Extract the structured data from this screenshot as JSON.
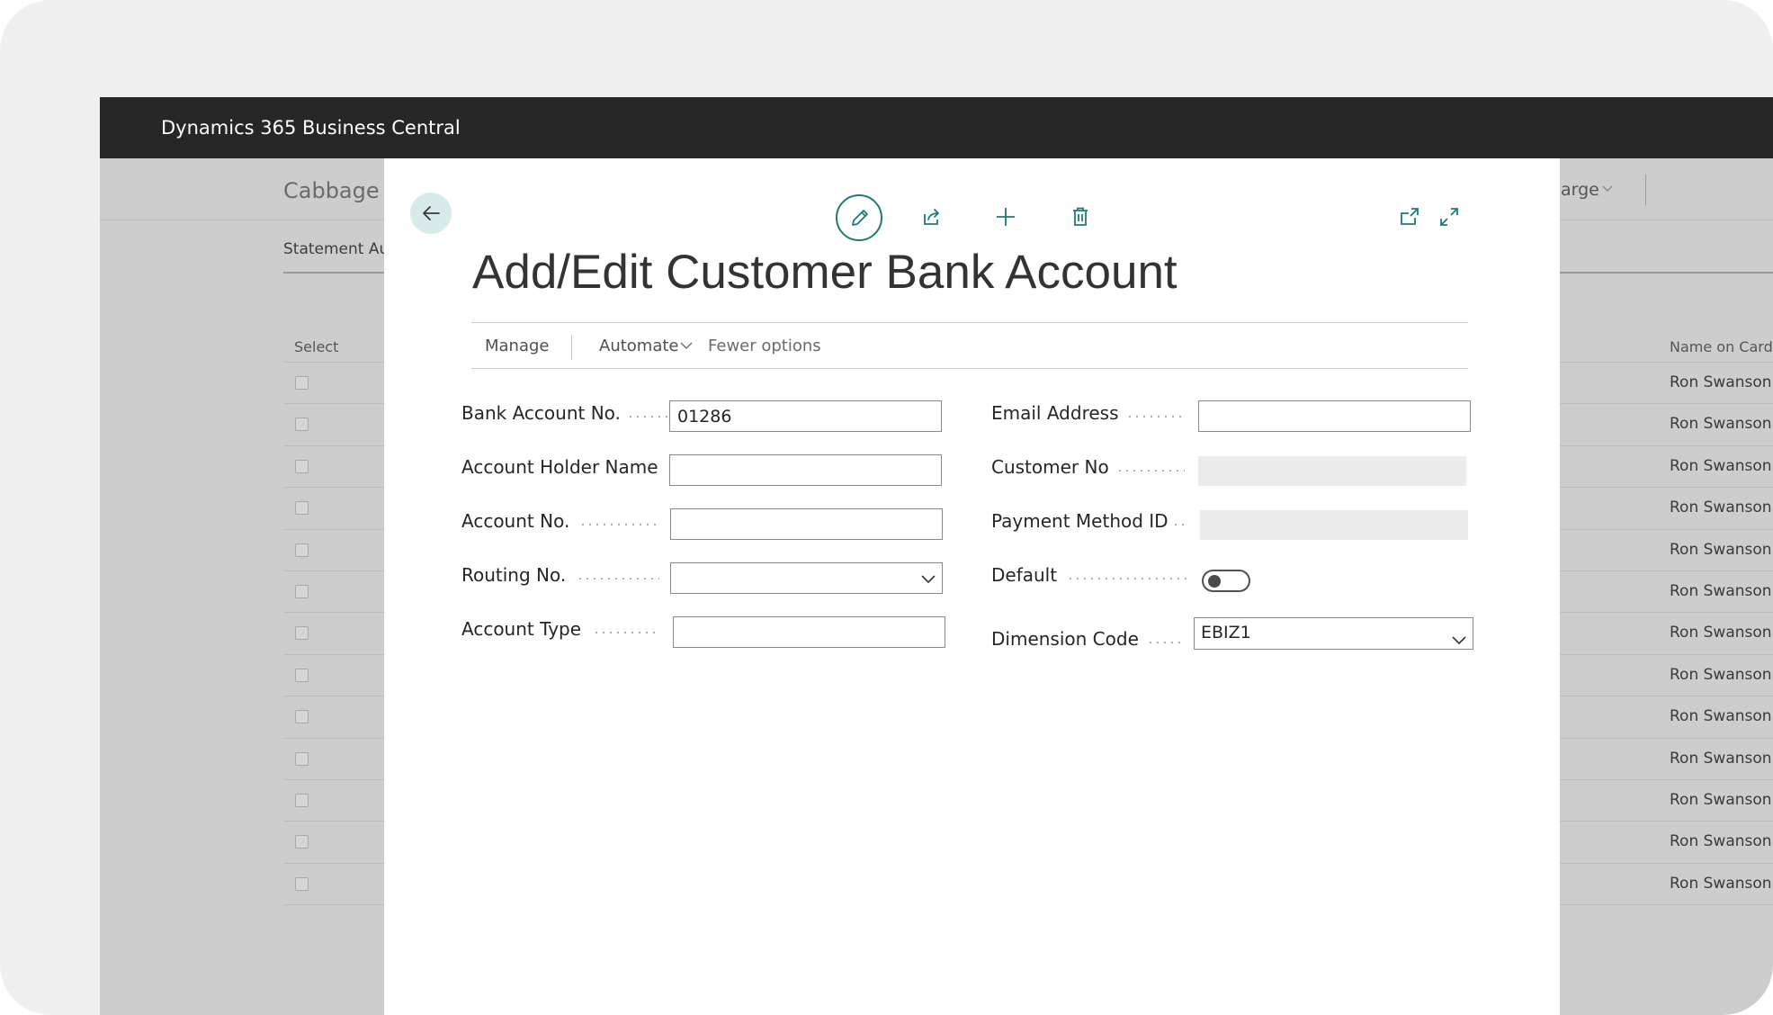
{
  "app": {
    "title": "Dynamics 365 Business Central"
  },
  "background_page": {
    "title": "Cabbage (",
    "subtab": "Statement Au",
    "right_action": "arge",
    "columns": {
      "select": "Select",
      "name_on_card": "Name on Card/"
    },
    "rows": [
      {
        "name": "Ron Swanson"
      },
      {
        "name": "Ron Swanson"
      },
      {
        "name": "Ron Swanson"
      },
      {
        "name": "Ron Swanson"
      },
      {
        "name": "Ron Swanson"
      },
      {
        "name": "Ron Swanson"
      },
      {
        "name": "Ron Swanson"
      },
      {
        "name": "Ron Swanson"
      },
      {
        "name": "Ron Swanson"
      },
      {
        "name": "Ron Swanson"
      },
      {
        "name": "Ron Swanson"
      },
      {
        "name": "Ron Swanson"
      },
      {
        "name": "Ron Swanson"
      }
    ]
  },
  "dialog": {
    "title": "Add/Edit Customer Bank Account",
    "toolbar_icons": [
      "back-arrow-icon",
      "pencil-icon",
      "share-icon",
      "plus-icon",
      "trash-icon",
      "pop-out-icon",
      "expand-icon"
    ],
    "actions": {
      "manage": "Manage",
      "automate": "Automate",
      "fewer_options": "Fewer options"
    },
    "fields": {
      "bank_account_no": {
        "label": "Bank Account No.",
        "value": "01286"
      },
      "account_holder_name": {
        "label": "Account Holder Name",
        "value": ""
      },
      "account_no": {
        "label": "Account No.",
        "value": ""
      },
      "routing_no": {
        "label": "Routing No.",
        "value": ""
      },
      "account_type": {
        "label": "Account Type",
        "value": ""
      },
      "email_address": {
        "label": "Email Address",
        "value": ""
      },
      "customer_no": {
        "label": "Customer No",
        "value": ""
      },
      "payment_method_id": {
        "label": "Payment Method ID",
        "value": ""
      },
      "default": {
        "label": "Default",
        "value": false
      },
      "dimension_code": {
        "label": "Dimension Code",
        "value": "EBIZ1"
      }
    }
  },
  "colors": {
    "accent": "#1f7a77",
    "appbar": "#262626",
    "back_button_bg": "#d6ebea"
  }
}
